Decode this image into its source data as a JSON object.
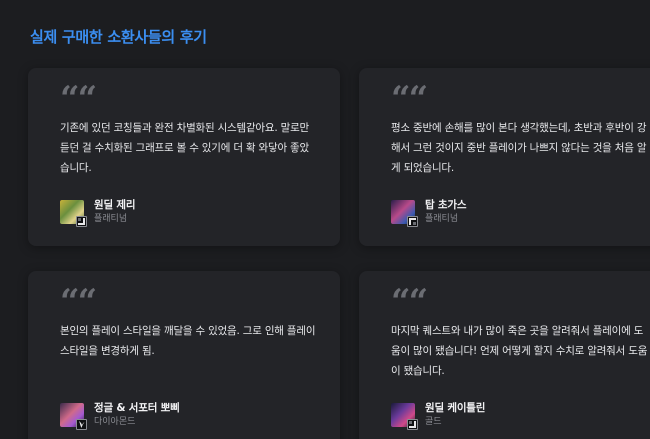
{
  "section": {
    "title": "실제 구매한 소환사들의 후기"
  },
  "quote_glyph": "“",
  "reviews": [
    {
      "text": "기존에 있던 코칭들과 완전 차별화된 시스템같아요. 말로만 듣던 걸 수치화된 그래프로 볼 수 있기에 더 확 와닿아 좋았습니다.",
      "author": "원딜 제리",
      "tier": "플래티넘",
      "lane_icon": "bottom-lane-icon"
    },
    {
      "text": "평소 중반에 손해를 많이 본다 생각했는데, 초반과 후반이 강해서 그런 것이지 중반 플레이가 나쁘지 않다는 것을 처음 알게 되었습니다.",
      "author": "탑 초가스",
      "tier": "플래티넘",
      "lane_icon": "top-lane-icon"
    },
    {
      "text": "본인의 플레이 스타일을 깨달을 수 있었음. 그로 인해 플레이 스타일을 변경하게 됨.",
      "author": "정글 & 서포터 뽀삐",
      "tier": "다이아몬드",
      "lane_icon": "jungle-lane-icon"
    },
    {
      "text": "마지막 퀘스트와 내가 많이 죽은 곳을 알려줘서 플레이에 도움이 많이 됐습니다! 언제 어떻게 할지 수치로 알려줘서 도움이 됐습니다.",
      "author": "원딜 케이틀린",
      "tier": "골드",
      "lane_icon": "bottom-lane-icon"
    }
  ]
}
